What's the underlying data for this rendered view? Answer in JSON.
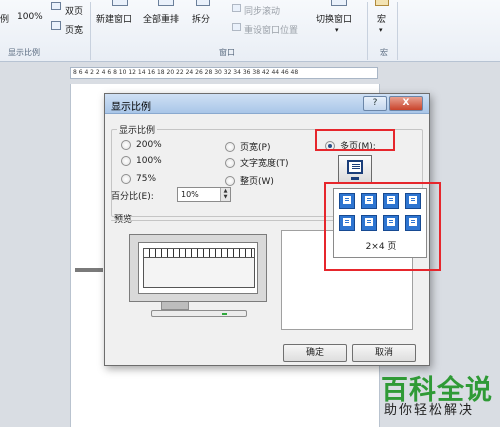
{
  "ribbon": {
    "view_items": {
      "view_label": "例",
      "zoom_100": "100%",
      "two_pages": "双页",
      "page_width": "页宽"
    },
    "group_zoom": "显示比例",
    "window_items": {
      "new_window": "新建窗口",
      "arrange_all": "全部重排",
      "split": "拆分",
      "sync_scroll": "同步滚动",
      "reset_position": "重设窗口位置",
      "switch_windows": "切换窗口"
    },
    "group_window": "窗口",
    "macro": "宏",
    "group_macro": "宏"
  },
  "ruler": {
    "text": "8 6 4 2 2 4 6 8 10 12 14 16 18 20 22 24 26 28 30 32 34 36 38 42 44 46 48"
  },
  "dialog": {
    "title": "显示比例",
    "help_button": "?",
    "close_button": "X",
    "zoom_group_label": "显示比例",
    "options": {
      "z200": "200%",
      "z100": "100%",
      "z75": "75%",
      "page_width": "页宽(P)",
      "text_width": "文字宽度(T)",
      "whole_page": "整页(W)",
      "many_pages": "多页(M):"
    },
    "selected_option": "many_pages",
    "percent_label": "百分比(E):",
    "percent_value": "10%",
    "preview_label": "预览",
    "grid_label": "2×4 页",
    "ok_button": "确定",
    "cancel_button": "取消"
  },
  "watermark": {
    "title": "百科全说",
    "subtitle": "助你轻松解决"
  },
  "colors": {
    "highlight_red": "#e6262c",
    "watermark_green": "#2f9a36",
    "grid_blue": "#2e75d1"
  },
  "icons": [
    "zoom-icon",
    "two-pages-icon",
    "page-width-icon",
    "new-window-icon",
    "arrange-all-icon",
    "split-icon",
    "sync-scroll-icon",
    "reset-window-icon",
    "switch-window-icon",
    "macro-icon",
    "multi-page-monitor-icon",
    "help-icon",
    "close-icon",
    "spinner-icon"
  ]
}
